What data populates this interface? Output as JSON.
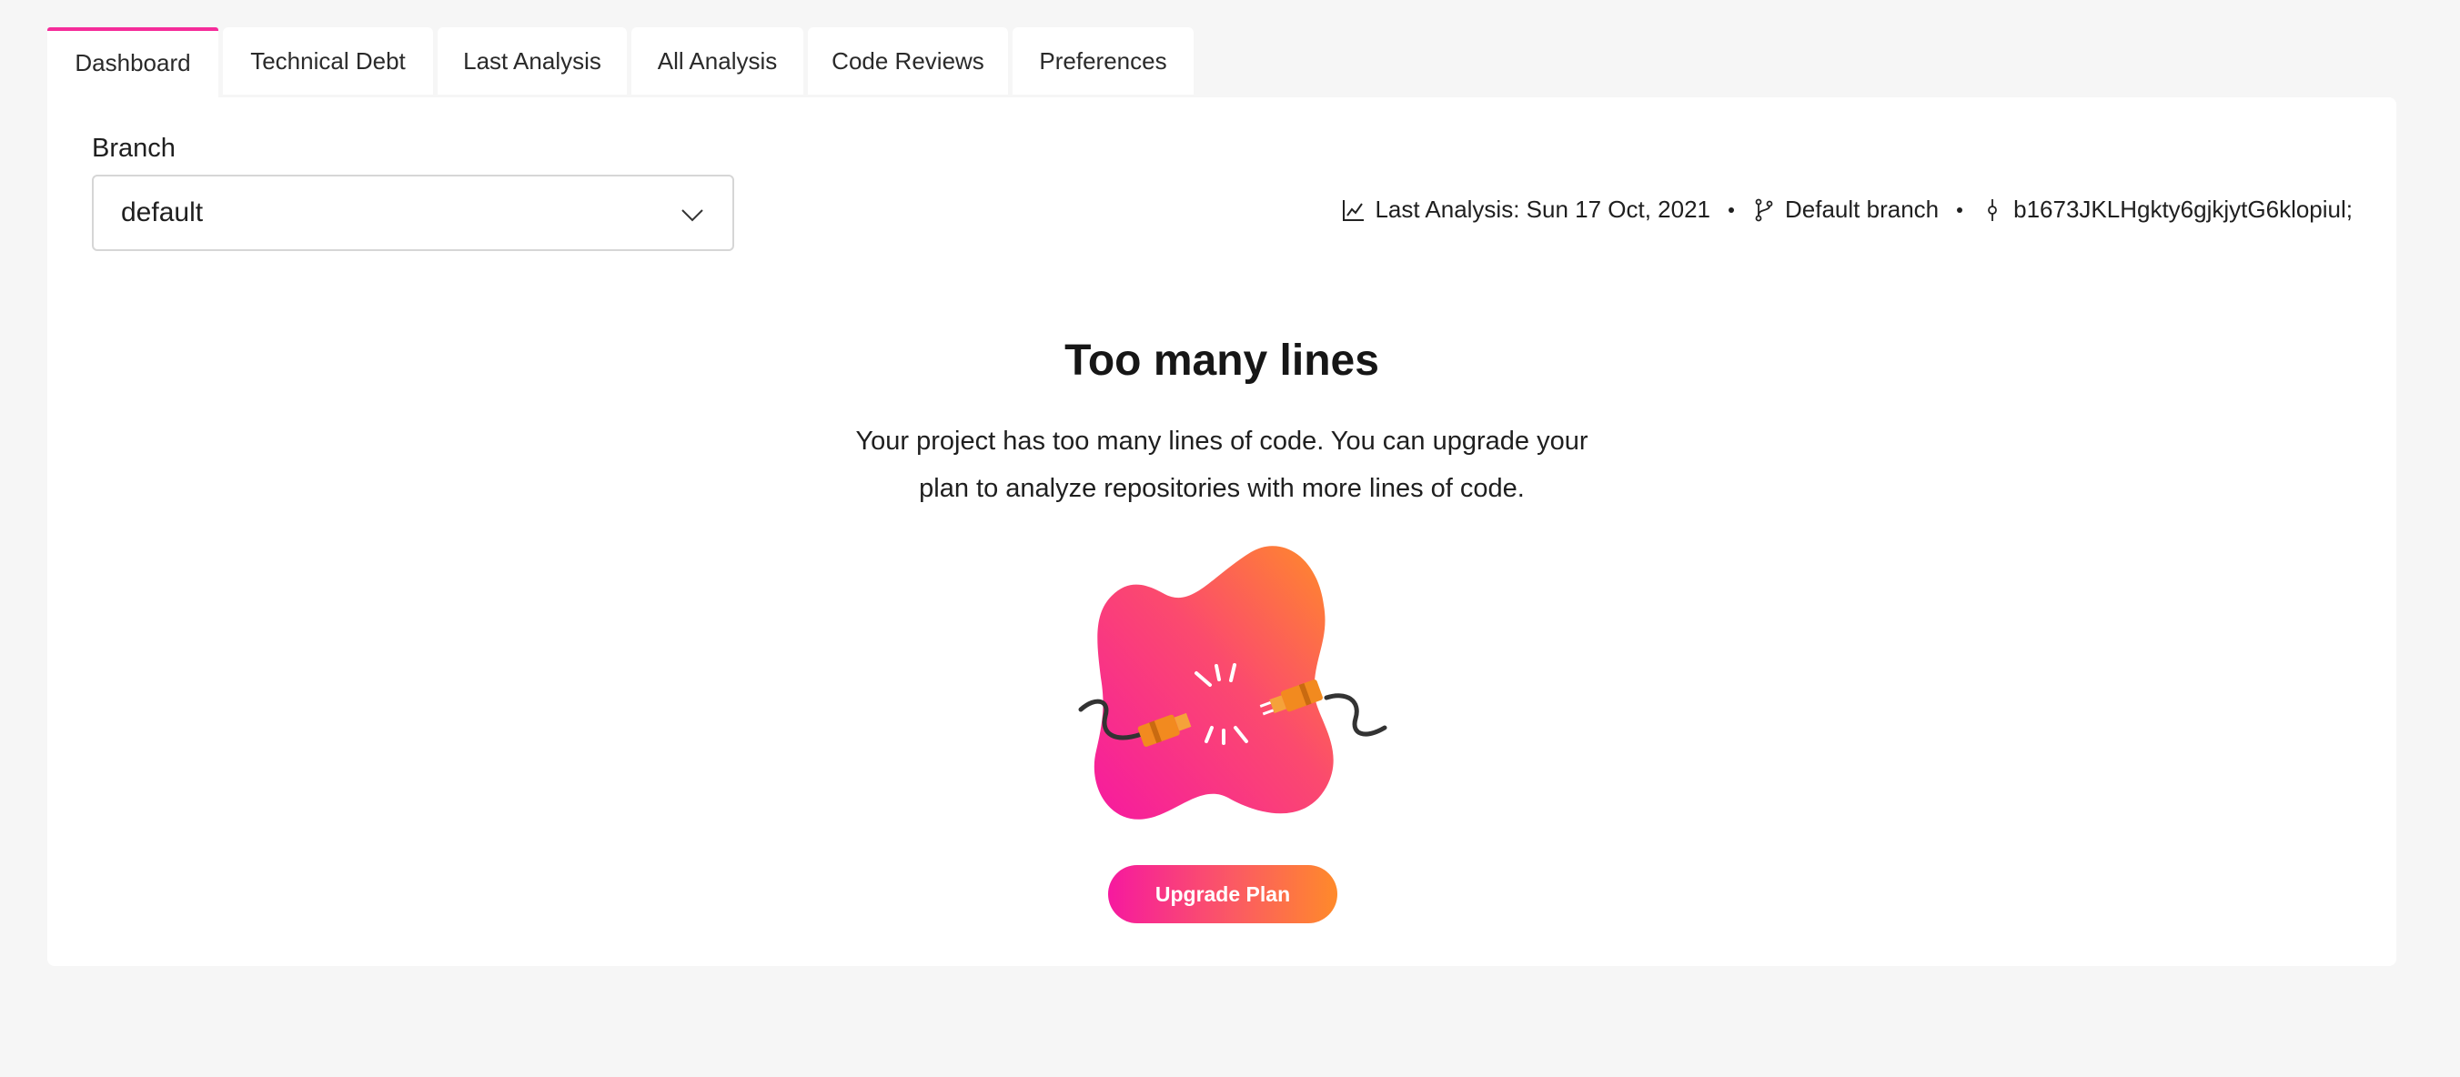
{
  "tabs": [
    {
      "label": "Dashboard",
      "active": true
    },
    {
      "label": "Technical Debt",
      "active": false
    },
    {
      "label": "Last Analysis",
      "active": false
    },
    {
      "label": "All Analysis",
      "active": false
    },
    {
      "label": "Code Reviews",
      "active": false
    },
    {
      "label": "Preferences",
      "active": false
    }
  ],
  "branch": {
    "label": "Branch",
    "selected": "default"
  },
  "meta": {
    "last_analysis": "Last Analysis: Sun 17 Oct, 2021",
    "branch_type": "Default branch",
    "commit": "b1673JKLHgkty6gjkjytG6klopiul;"
  },
  "empty_state": {
    "title": "Too many lines",
    "description": "Your project has too many lines of code. You can upgrade your plan to analyze repositories with more lines of code.",
    "button_label": "Upgrade Plan"
  },
  "colors": {
    "accent": "#f52c9a",
    "gradient_start": "#f6199f",
    "gradient_end": "#ff8a2a",
    "background": "#f6f6f6",
    "panel": "#ffffff"
  },
  "icons": {
    "chart": "line-chart-icon",
    "branch": "git-branch-icon",
    "commit": "git-commit-icon",
    "dropdown": "chevron-down-icon",
    "illustration": "disconnected-plug-illustration"
  }
}
